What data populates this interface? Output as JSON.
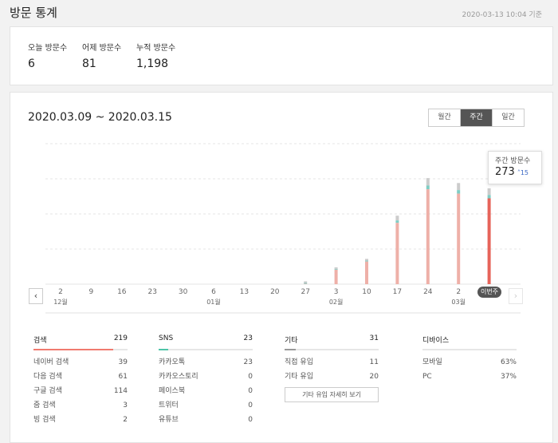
{
  "header": {
    "title": "방문 통계",
    "timestamp": "2020-03-13 10:04 기준"
  },
  "summary": [
    {
      "label": "오늘 방문수",
      "value": "6"
    },
    {
      "label": "어제 방문수",
      "value": "81"
    },
    {
      "label": "누적 방문수",
      "value": "1,198"
    }
  ],
  "range": "2020.03.09 ~ 2020.03.15",
  "period_toggle": {
    "options": [
      "월간",
      "주간",
      "일간"
    ],
    "selected": "주간"
  },
  "tooltip": {
    "label": "주간 방문수",
    "value": "273",
    "delta": "15"
  },
  "current_week_label": "이번주",
  "colors": {
    "bar_total": "#cccccc",
    "bar_mid": "#7fcdc4",
    "bar_main": "#eeb0a8",
    "bar_current": "#e6645a",
    "accent_search": "#f07a6f",
    "accent_sns": "#4ec4a8",
    "accent_other": "#999999"
  },
  "chart_data": {
    "type": "bar",
    "x_ticks": [
      "2",
      "9",
      "16",
      "23",
      "30",
      "6",
      "13",
      "20",
      "27",
      "3",
      "10",
      "17",
      "24",
      "2",
      "이번주"
    ],
    "month_labels": [
      {
        "label": "12월",
        "at": "2"
      },
      {
        "label": "01월",
        "at": "6"
      },
      {
        "label": "02월",
        "at": "3"
      },
      {
        "label": "03월",
        "at": "2"
      }
    ],
    "series": [
      {
        "values": [
          0,
          0,
          0,
          0,
          0,
          0,
          0,
          0,
          8,
          48,
          72,
          195,
          302,
          288,
          273
        ]
      }
    ],
    "ylim": [
      0,
      400
    ],
    "grid": true
  },
  "stats": {
    "search": {
      "title": "검색",
      "total": "219",
      "items": [
        {
          "label": "네이버 검색",
          "value": "39"
        },
        {
          "label": "다음 검색",
          "value": "61"
        },
        {
          "label": "구글 검색",
          "value": "114"
        },
        {
          "label": "줌 검색",
          "value": "3"
        },
        {
          "label": "빙 검색",
          "value": "2"
        }
      ]
    },
    "sns": {
      "title": "SNS",
      "total": "23",
      "items": [
        {
          "label": "카카오톡",
          "value": "23"
        },
        {
          "label": "카카오스토리",
          "value": "0"
        },
        {
          "label": "페이스북",
          "value": "0"
        },
        {
          "label": "트위터",
          "value": "0"
        },
        {
          "label": "유튜브",
          "value": "0"
        }
      ]
    },
    "other": {
      "title": "기타",
      "total": "31",
      "items": [
        {
          "label": "직접 유입",
          "value": "11"
        },
        {
          "label": "기타 유입",
          "value": "20"
        }
      ],
      "detail_button": "기타 유입 자세히 보기"
    },
    "device": {
      "title": "디바이스",
      "items": [
        {
          "label": "모바일",
          "value": "63%"
        },
        {
          "label": "PC",
          "value": "37%"
        }
      ]
    }
  }
}
